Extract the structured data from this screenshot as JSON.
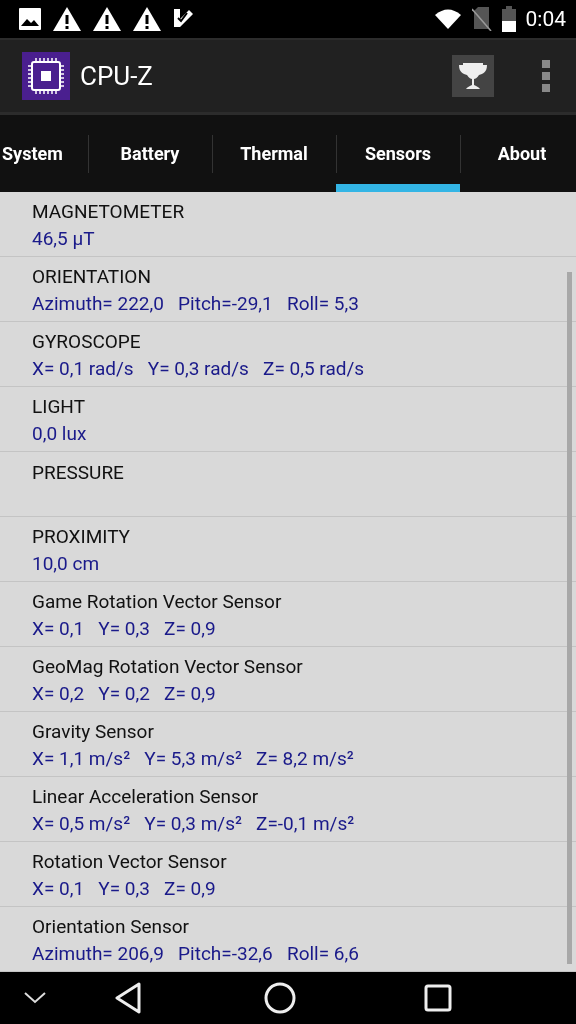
{
  "status_bar": {
    "time": "0:04"
  },
  "app_bar": {
    "title": "CPU-Z"
  },
  "tabs": [
    {
      "label": "System",
      "selected": false
    },
    {
      "label": "Battery",
      "selected": false
    },
    {
      "label": "Thermal",
      "selected": false
    },
    {
      "label": "Sensors",
      "selected": true
    },
    {
      "label": "About",
      "selected": false
    }
  ],
  "sensors": [
    {
      "name": "MAGNETOMETER",
      "value": "46,5 µT"
    },
    {
      "name": "ORIENTATION",
      "value": "Azimuth= 222,0   Pitch=-29,1   Roll= 5,3"
    },
    {
      "name": "GYROSCOPE",
      "value": "X= 0,1 rad/s   Y= 0,3 rad/s   Z= 0,5 rad/s"
    },
    {
      "name": "LIGHT",
      "value": "0,0 lux"
    },
    {
      "name": "PRESSURE"
    },
    {
      "name": "PROXIMITY",
      "value": "10,0 cm"
    },
    {
      "name": "Game Rotation Vector Sensor",
      "value": "X= 0,1   Y= 0,3   Z= 0,9"
    },
    {
      "name": "GeoMag Rotation Vector Sensor",
      "value": "X= 0,2   Y= 0,2   Z= 0,9"
    },
    {
      "name": "Gravity Sensor",
      "value": "X= 1,1 m/s²   Y= 5,3 m/s²   Z= 8,2 m/s²"
    },
    {
      "name": "Linear Acceleration Sensor",
      "value": "X= 0,5 m/s²   Y= 0,3 m/s²   Z=-0,1 m/s²"
    },
    {
      "name": "Rotation Vector Sensor",
      "value": "X= 0,1   Y= 0,3   Z= 0,9"
    },
    {
      "name": "Orientation Sensor",
      "value": "Azimuth= 206,9   Pitch=-32,6   Roll= 6,6"
    }
  ]
}
